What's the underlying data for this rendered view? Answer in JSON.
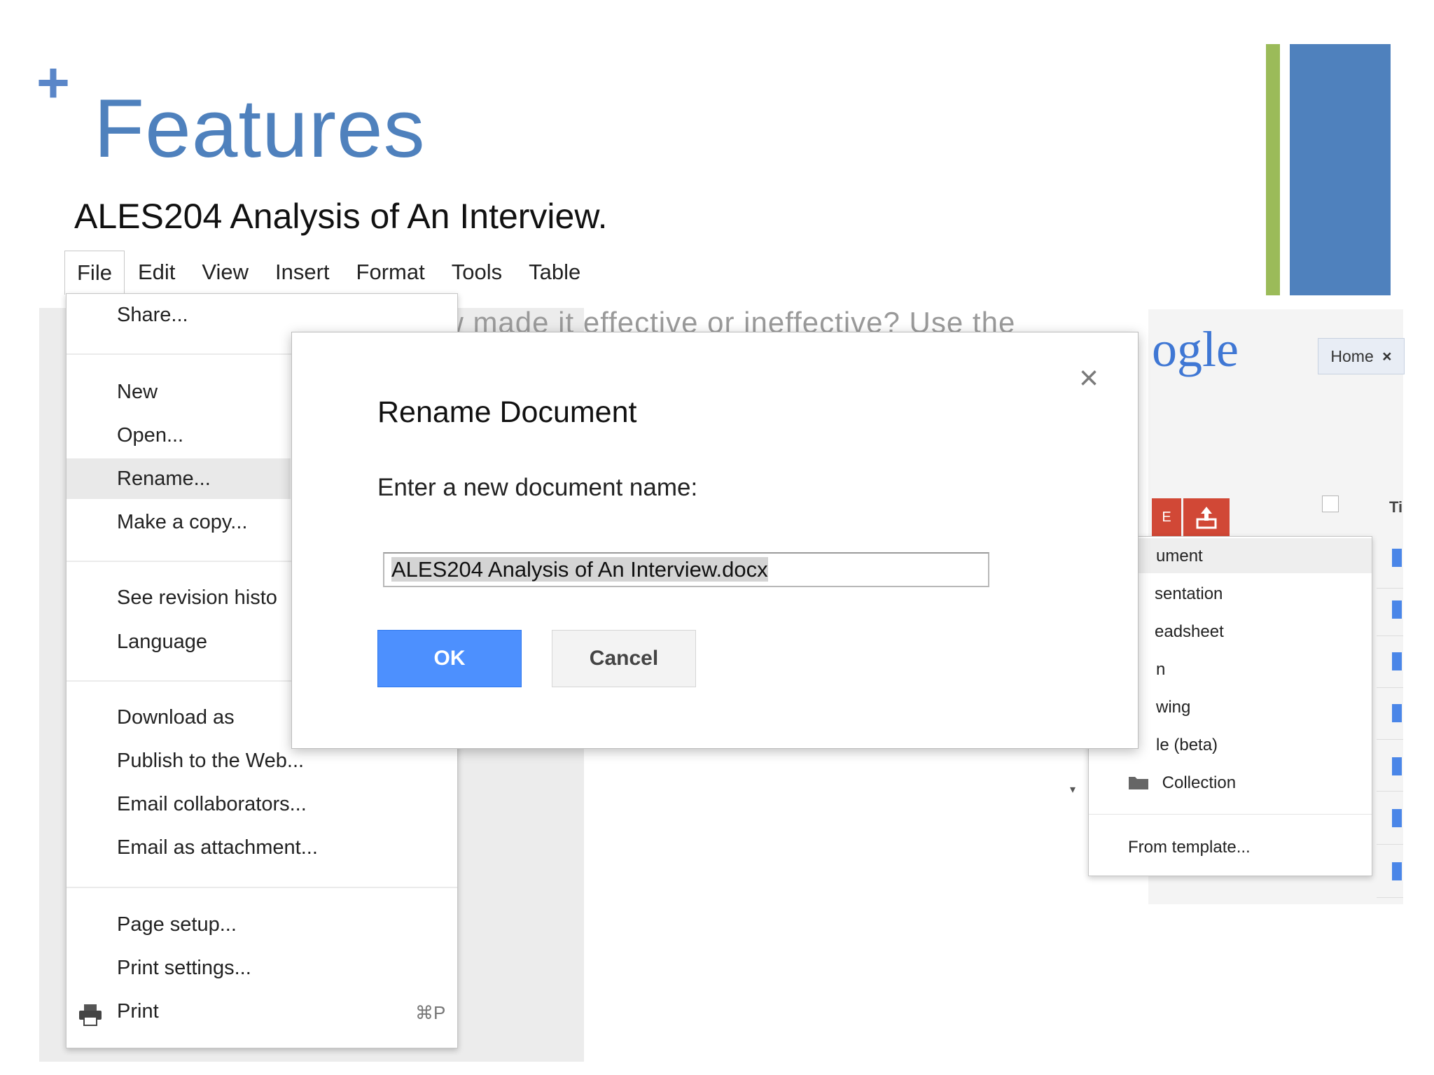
{
  "slide": {
    "plus": "+",
    "title": "Features"
  },
  "document": {
    "title": "ALES204 Analysis of An Interview.",
    "menubar": [
      "File",
      "Edit",
      "View",
      "Insert",
      "Format",
      "Tools",
      "Table"
    ]
  },
  "file_menu": {
    "items": [
      "Share...",
      "New",
      "Open...",
      "Rename...",
      "Make a copy...",
      "See revision histo",
      "Language",
      "Download as",
      "Publish to the Web...",
      "Email collaborators...",
      "Email as attachment...",
      "Page setup...",
      "Print settings...",
      "Print"
    ],
    "highlighted": "Rename...",
    "print_shortcut": "⌘P"
  },
  "background_text": {
    "line1": "the interview made it effective or ineffective?  Use the"
  },
  "dialog": {
    "title": "Rename Document",
    "close": "×",
    "label": "Enter a new document name:",
    "input_value": "ALES204 Analysis of An Interview.docx",
    "ok": "OK",
    "cancel": "Cancel"
  },
  "docs_list": {
    "logo": "ogle",
    "home_tab": "Home",
    "home_close": "×",
    "create_button_fragment": "E",
    "column_header": "Ti",
    "new_menu_items": [
      "ument",
      "sentation",
      "eadsheet",
      "n",
      "wing",
      "le (beta)",
      "Collection",
      "From template..."
    ]
  },
  "colors": {
    "accent_blue": "#4f81bd",
    "accent_green": "#9bbb59",
    "ok_button": "#4d90fe",
    "google_red_button": "#d14836"
  }
}
